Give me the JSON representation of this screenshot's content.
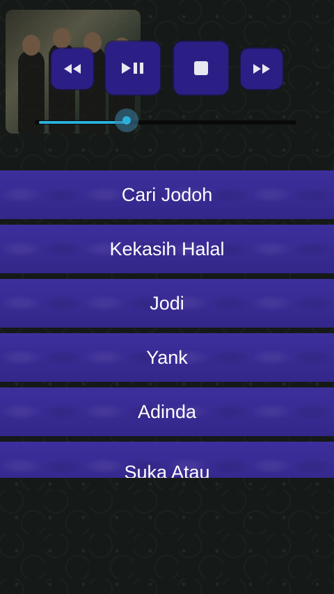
{
  "player": {
    "controls": [
      {
        "name": "rewind-button",
        "icon": "rewind-icon"
      },
      {
        "name": "play-pause-button",
        "icon": "play-pause-icon"
      },
      {
        "name": "stop-button",
        "icon": "stop-icon"
      },
      {
        "name": "fast-forward-button",
        "icon": "fast-forward-icon"
      }
    ],
    "progress": 0.35,
    "accent_color": "#2ab0d8",
    "button_color": "#2b1f86"
  },
  "playlist": {
    "item_color": "#3a2d95",
    "items": [
      {
        "label": "Cari Jodoh"
      },
      {
        "label": "Kekasih Halal"
      },
      {
        "label": "Jodi"
      },
      {
        "label": "Yank"
      },
      {
        "label": "Adinda"
      },
      {
        "label": "Suka Atau"
      }
    ]
  }
}
